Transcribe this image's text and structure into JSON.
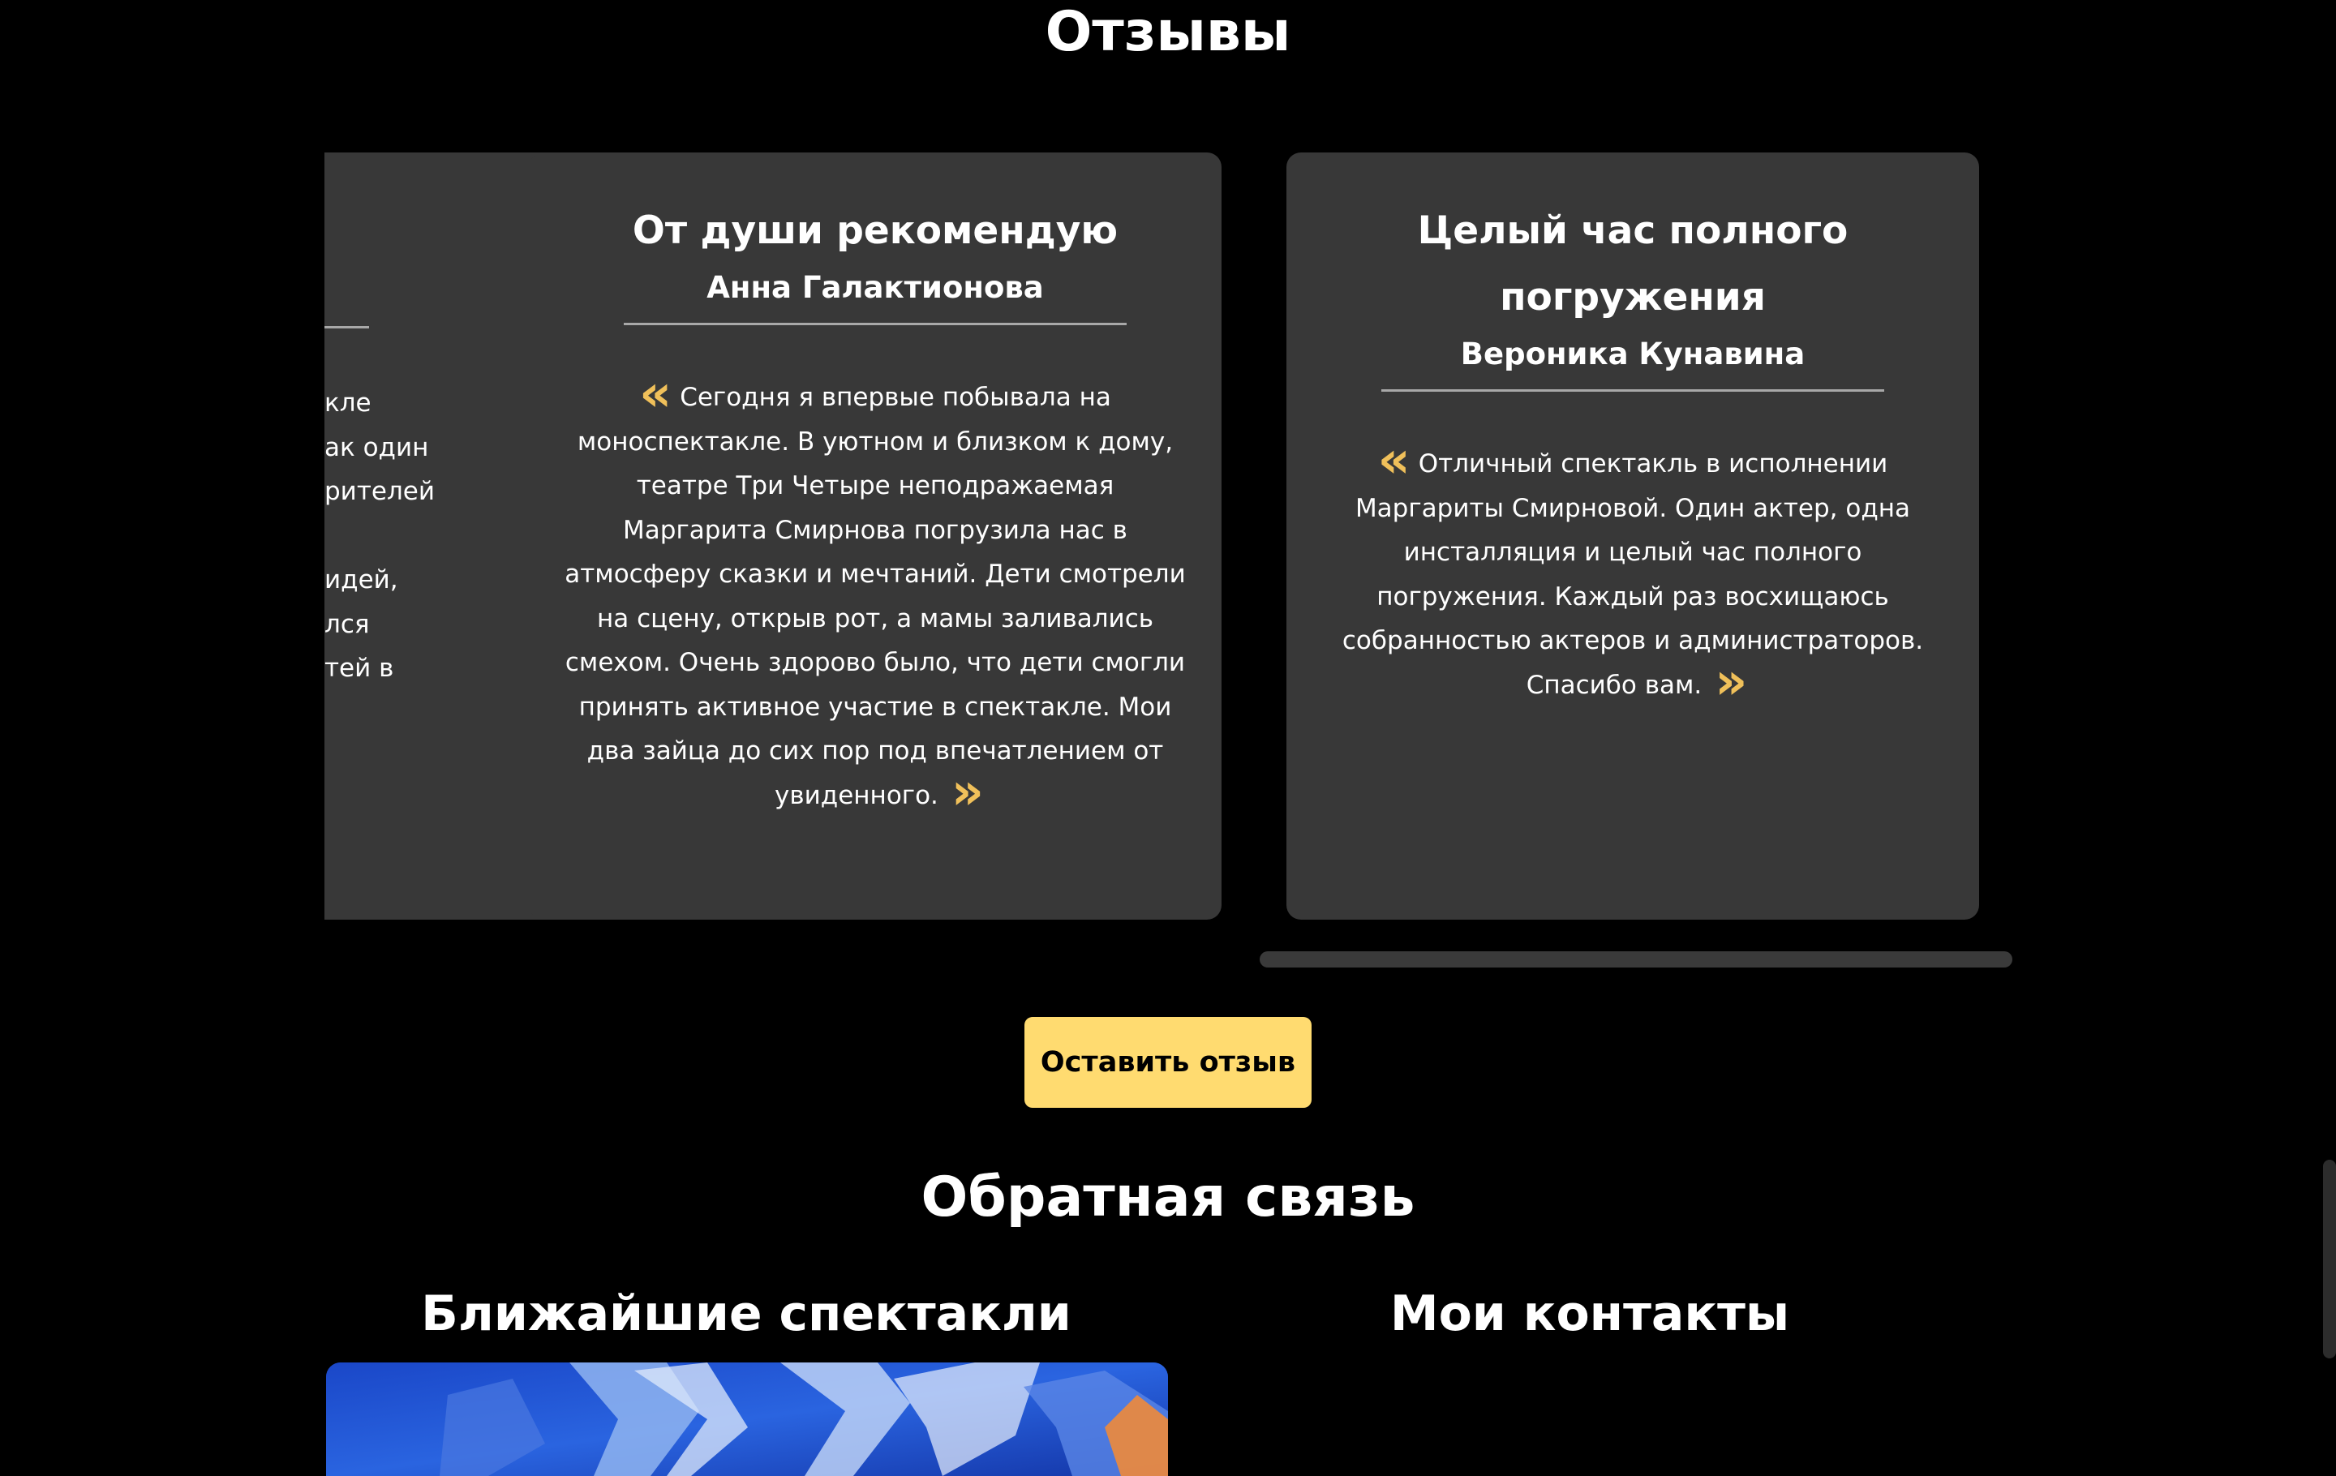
{
  "reviews": {
    "title": "Отзывы",
    "cards": [
      {
        "title": "",
        "author": "",
        "text_lines": [
          "кле",
          "ак один",
          "рителей",
          "",
          "идей,",
          "лся",
          "тей в"
        ]
      },
      {
        "title": "От души рекомендую",
        "author": "Анна Галактионова",
        "text": "Сегодня я впервые побывала на моноспектакле. В уютном и близком к дому, театре Три Четыре неподражаемая Маргарита Смирнова погрузила нас в атмосферу сказки и мечтаний. Дети смотрели на сцену, открыв рот, а мамы заливались смехом. Очень здорово было, что дети смогли принять активное участие в спектакле. Мои два зайца до сих пор под впечатлением от увиденного."
      },
      {
        "title": "Целый час полного погружения",
        "author": "Вероника Кунавина",
        "text": "Отличный спектакль в исполнении Маргариты Смирновой. Один актер, одна инсталляция и целый час полного погружения. Каждый раз восхищаюсь собранностью актеров и администраторов. Спасибо вам."
      }
    ],
    "leave_review_label": "Оставить отзыв"
  },
  "feedback": {
    "title": "Обратная связь",
    "shows_title": "Ближайшие спектакли",
    "contacts_title": "Мои контакты"
  },
  "icons": {
    "quote_open": "quote-open-icon",
    "quote_close": "quote-close-icon"
  },
  "colors": {
    "background": "#000000",
    "card": "#383838",
    "accent": "#ffdb70",
    "quote": "#f0c05a",
    "divider": "#a8a8a8"
  }
}
